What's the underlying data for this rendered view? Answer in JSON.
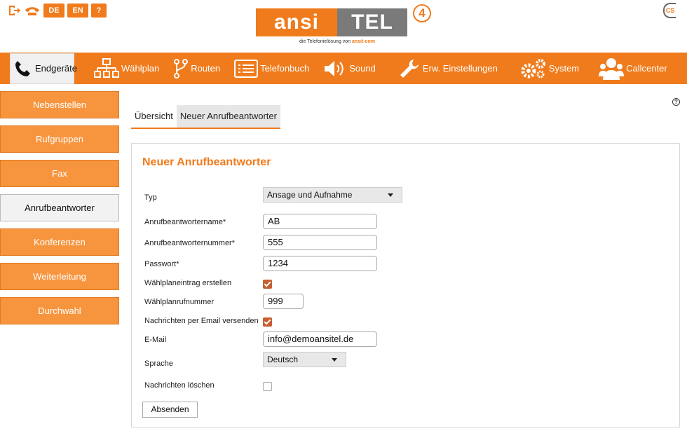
{
  "top_icons": {
    "logout": "logout-icon",
    "hangup": "hangup-icon",
    "lang_de": "DE",
    "lang_en": "EN",
    "help": "?"
  },
  "logo": {
    "part1": "ansi",
    "part2": "TEL",
    "version": "4",
    "tagline_prefix": "die Telefonielösung von ",
    "tagline_brand": "ansit-com"
  },
  "nav": {
    "items": [
      {
        "label": "Endgeräte",
        "icon": "phone-icon",
        "active": true
      },
      {
        "label": "Wählplan",
        "icon": "sitemap-icon"
      },
      {
        "label": "Routen",
        "icon": "route-icon"
      },
      {
        "label": "Telefonbuch",
        "icon": "list-icon"
      },
      {
        "label": "Sound",
        "icon": "speaker-icon"
      },
      {
        "label": "Erw. Einstellungen",
        "icon": "wrench-icon"
      },
      {
        "label": "System",
        "icon": "gears-icon"
      },
      {
        "label": "Callcenter",
        "icon": "users-icon"
      }
    ]
  },
  "sidebar": {
    "items": [
      {
        "label": "Nebenstellen"
      },
      {
        "label": "Rufgruppen"
      },
      {
        "label": "Fax"
      },
      {
        "label": "Anrufbeantworter",
        "active": true
      },
      {
        "label": "Konferenzen"
      },
      {
        "label": "Weiterleitung"
      },
      {
        "label": "Durchwahl"
      }
    ]
  },
  "tabs": {
    "overview": "Übersicht",
    "new": "Neuer Anrufbeantworter"
  },
  "form": {
    "title": "Neuer Anrufbeantworter",
    "typ_label": "Typ",
    "typ_value": "Ansage und Aufnahme",
    "name_label": "Anrufbeantwortername*",
    "name_value": "AB",
    "number_label": "Anrufbeantworternummer*",
    "number_value": "555",
    "password_label": "Passwort*",
    "password_value": "1234",
    "dialplan_entry_label": "Wählplaneintrag erstellen",
    "dialplan_entry_checked": true,
    "dialplan_number_label": "Wählplanrufnummer",
    "dialplan_number_value": "999",
    "email_send_label": "Nachrichten per Email versenden",
    "email_send_checked": true,
    "email_label": "E-Mail",
    "email_value": "info@demoansitel.de",
    "language_label": "Sprache",
    "language_value": "Deutsch",
    "delete_label": "Nachrichten löschen",
    "delete_checked": false,
    "submit_label": "Absenden"
  },
  "colors": {
    "accent": "#f07b1c",
    "sidebar_button": "#f7953f",
    "checkbox": "#c55f31",
    "logo_grey": "#7a7a7a"
  }
}
